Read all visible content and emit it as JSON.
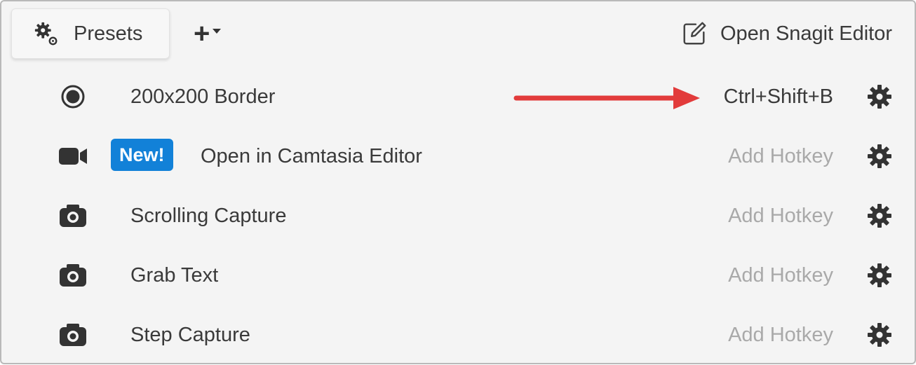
{
  "toolbar": {
    "presets_label": "Presets",
    "add_label": "+",
    "open_editor_label": "Open Snagit Editor"
  },
  "presets": [
    {
      "name": "200x200 Border",
      "hotkey": "Ctrl+Shift+B",
      "icon": "radio-record-icon"
    },
    {
      "name": "Open in Camtasia Editor",
      "hotkey": "Add Hotkey",
      "icon": "video-camera-icon",
      "badge": "New!"
    },
    {
      "name": "Scrolling Capture",
      "hotkey": "Add Hotkey",
      "icon": "camera-icon"
    },
    {
      "name": "Grab Text",
      "hotkey": "Add Hotkey",
      "icon": "camera-icon"
    },
    {
      "name": "Step Capture",
      "hotkey": "Add Hotkey",
      "icon": "camera-icon"
    }
  ],
  "colors": {
    "badge": "#1281d8",
    "annotation_arrow": "#e23b3b",
    "hotkey_placeholder": "#a9a9a9"
  }
}
